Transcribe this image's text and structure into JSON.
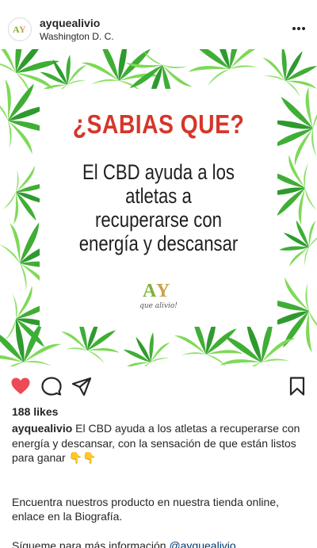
{
  "header": {
    "username": "ayquealivio",
    "location": "Washington D. C."
  },
  "post": {
    "headline": "¿SABIAS QUE?",
    "body_lines": [
      "El CBD ayuda a los",
      "atletas a",
      "recuperarse con",
      "energía y descansar"
    ],
    "logo_text": "que alivio!",
    "logo_monogram": "AY"
  },
  "actions": {
    "liked": true,
    "like_color": "#ed4956"
  },
  "likes": "188 likes",
  "caption": {
    "username": "ayquealivio",
    "text": " El CBD ayuda a los atletas a recuperarse con energía y descansar, con la sensación de que están listos para ganar 👇👇",
    "paragraph2": "Encuentra nuestros producto en nuestra tienda online, enlace en la Biografía.",
    "paragraph3_prefix": "Sígueme para más información ",
    "mention": "@ayquealivio"
  },
  "colors": {
    "headline": "#d6362a",
    "leaf_dark": "#2e9a2e",
    "leaf_light": "#7ed957",
    "logo_gold": "#c9a34a"
  }
}
